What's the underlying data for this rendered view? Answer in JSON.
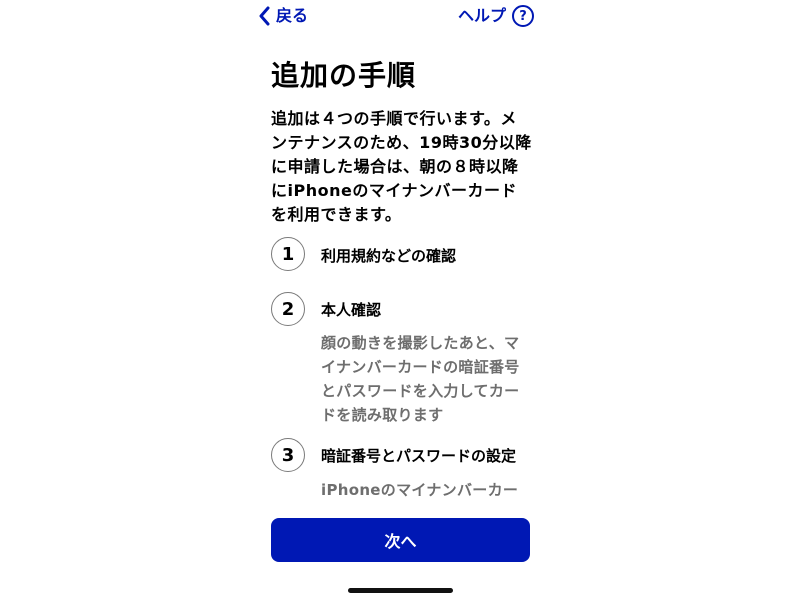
{
  "colors": {
    "accent": "#0018b4",
    "text": "#000000",
    "secondary_text": "#6e6e6e",
    "button_text": "#ffffff"
  },
  "nav": {
    "back_label": "戻る",
    "help_label": "ヘルプ",
    "help_icon": "question-circle-icon",
    "back_icon": "chevron-left-icon"
  },
  "title": "追加の手順",
  "intro": "追加は４つの手順で行います。メンテナンスのため、19時30分以降に申請した場合は、朝の８時以降にiPhoneのマイナンバーカードを利用できます。",
  "steps": [
    {
      "number": "1",
      "title": "利用規約などの確認",
      "description": ""
    },
    {
      "number": "2",
      "title": "本人確認",
      "description": "顔の動きを撮影したあと、マイナンバーカードの暗証番号とパスワードを入力してカードを読み取ります"
    },
    {
      "number": "3",
      "title": "暗証番号とパスワードの設定",
      "description": "iPhoneのマイナンバーカー"
    }
  ],
  "next_button_label": "次へ"
}
